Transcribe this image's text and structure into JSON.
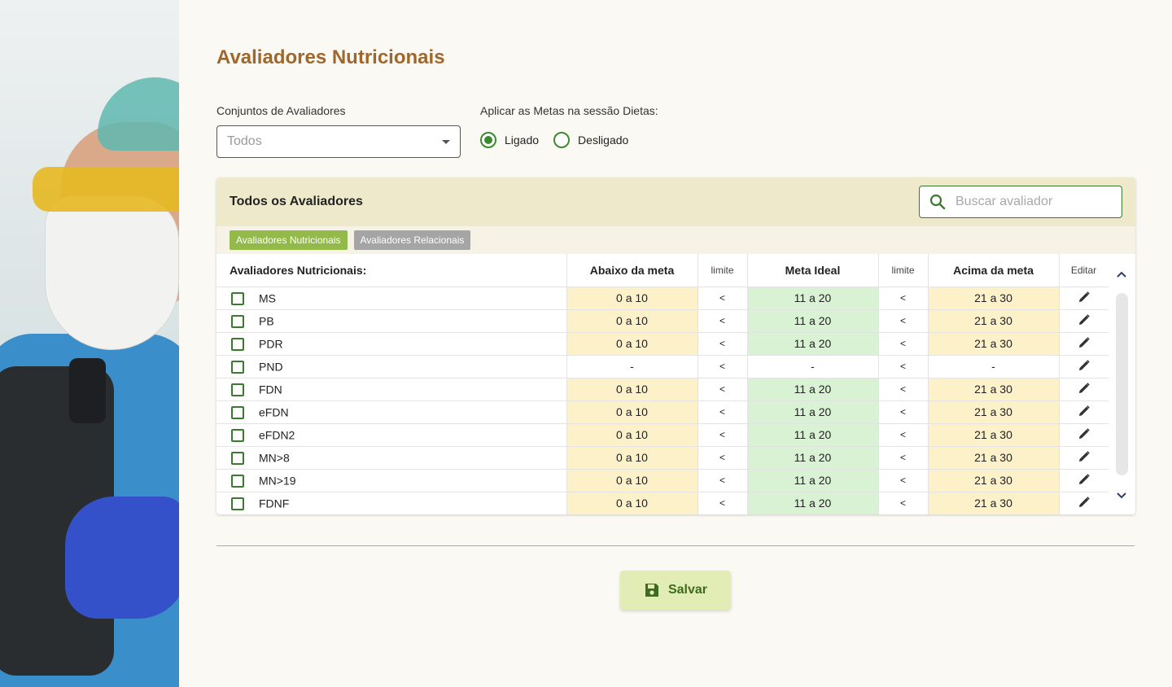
{
  "page": {
    "title": "Avaliadores Nutricionais"
  },
  "filters": {
    "set_label": "Conjuntos de Avaliadores",
    "set_value": "Todos",
    "goals_label": "Aplicar as Metas na sessão Dietas:",
    "radio_on": "Ligado",
    "radio_off": "Desligado",
    "selected": "Ligado"
  },
  "card": {
    "title": "Todos os Avaliadores",
    "search_placeholder": "Buscar avaliador",
    "tabs": [
      "Avaliadores Nutricionais",
      "Avaliadores Relacionais"
    ]
  },
  "table": {
    "headers": {
      "name": "Avaliadores Nutricionais:",
      "below": "Abaixo da meta",
      "limit1": "limite",
      "ideal": "Meta Ideal",
      "limit2": "limite",
      "above": "Acima da meta",
      "edit": "Editar"
    },
    "rows": [
      {
        "name": "MS",
        "below": "0 a 10",
        "limit1": "<",
        "ideal": "11 a 20",
        "limit2": "<",
        "above": "21 a 30",
        "colored": true
      },
      {
        "name": "PB",
        "below": "0 a 10",
        "limit1": "<",
        "ideal": "11 a 20",
        "limit2": "<",
        "above": "21 a 30",
        "colored": true
      },
      {
        "name": "PDR",
        "below": "0 a 10",
        "limit1": "<",
        "ideal": "11 a 20",
        "limit2": "<",
        "above": "21 a 30",
        "colored": true
      },
      {
        "name": "PND",
        "below": "-",
        "limit1": "<",
        "ideal": "-",
        "limit2": "<",
        "above": "-",
        "colored": false
      },
      {
        "name": "FDN",
        "below": "0 a 10",
        "limit1": "<",
        "ideal": "11 a 20",
        "limit2": "<",
        "above": "21 a 30",
        "colored": true
      },
      {
        "name": "eFDN",
        "below": "0 a 10",
        "limit1": "<",
        "ideal": "11 a 20",
        "limit2": "<",
        "above": "21 a 30",
        "colored": true
      },
      {
        "name": "eFDN2",
        "below": "0 a 10",
        "limit1": "<",
        "ideal": "11 a 20",
        "limit2": "<",
        "above": "21 a 30",
        "colored": true
      },
      {
        "name": "MN>8",
        "below": "0 a 10",
        "limit1": "<",
        "ideal": "11 a 20",
        "limit2": "<",
        "above": "21 a 30",
        "colored": true
      },
      {
        "name": "MN>19",
        "below": "0 a 10",
        "limit1": "<",
        "ideal": "11 a 20",
        "limit2": "<",
        "above": "21 a 30",
        "colored": true
      },
      {
        "name": "FDNF",
        "below": "0 a 10",
        "limit1": "<",
        "ideal": "11 a 20",
        "limit2": "<",
        "above": "21 a 30",
        "colored": true
      }
    ]
  },
  "actions": {
    "save_label": "Salvar"
  },
  "icons": {
    "search": "search-icon",
    "edit": "pencil-icon",
    "save": "floppy-disk-icon",
    "scroll_up": "chevron-up-icon",
    "scroll_down": "chevron-down-icon",
    "dropdown": "caret-down-icon"
  },
  "colors": {
    "title": "#a0672a",
    "accent_green": "#3b8a2e",
    "below_cell": "#fdf1c9",
    "ideal_cell": "#d9f2d3",
    "header_band": "#efe9cb",
    "tab_active": "#93b94b",
    "tab_inactive": "#a5a5a5",
    "save_bg": "#e2edb6"
  }
}
